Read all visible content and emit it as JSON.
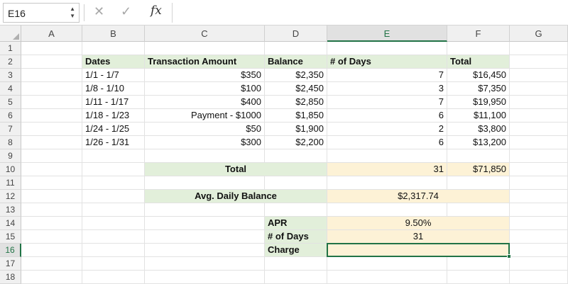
{
  "name_box": "E16",
  "formula": "",
  "toolbar": {
    "cancel_icon": "✕",
    "enter_icon": "✓",
    "fx_label": "fx"
  },
  "columns": [
    "A",
    "B",
    "C",
    "D",
    "E",
    "F",
    "G"
  ],
  "selected_column": "E",
  "rows": [
    "1",
    "2",
    "3",
    "4",
    "5",
    "6",
    "7",
    "8",
    "9",
    "10",
    "11",
    "12",
    "13",
    "14",
    "15",
    "16",
    "17",
    "18"
  ],
  "selected_row": "16",
  "cells": {
    "B2": "Dates",
    "C2": "Transaction Amount",
    "D2": "Balance",
    "E2": "# of Days",
    "F2": "Total",
    "B3": "1/1 - 1/7",
    "C3": "$350",
    "D3": "$2,350",
    "E3": "7",
    "F3": "$16,450",
    "B4": "1/8 - 1/10",
    "C4": "$100",
    "D4": "$2,450",
    "E4": "3",
    "F4": "$7,350",
    "B5": "1/11 - 1/17",
    "C5": "$400",
    "D5": "$2,850",
    "E5": "7",
    "F5": "$19,950",
    "B6": "1/18 - 1/23",
    "C6": "Payment - $1000",
    "D6": "$1,850",
    "E6": "6",
    "F6": "$11,100",
    "B7": "1/24 - 1/25",
    "C7": "$50",
    "D7": "$1,900",
    "E7": "2",
    "F7": "$3,800",
    "B8": "1/26 - 1/31",
    "C8": "$300",
    "D8": "$2,200",
    "E8": "6",
    "F8": "$13,200",
    "C10": "Total",
    "E10": "31",
    "F10": "$71,850",
    "C12": "Avg. Daily Balance",
    "E12": "$2,317.74",
    "D14": "APR",
    "E14": "9.50%",
    "D15": "# of Days",
    "E15": "31",
    "D16": "Charge",
    "E16": ""
  },
  "colors": {
    "header_fill": "#e2efda",
    "value_fill": "#fdf2d6",
    "selection": "#217346"
  }
}
